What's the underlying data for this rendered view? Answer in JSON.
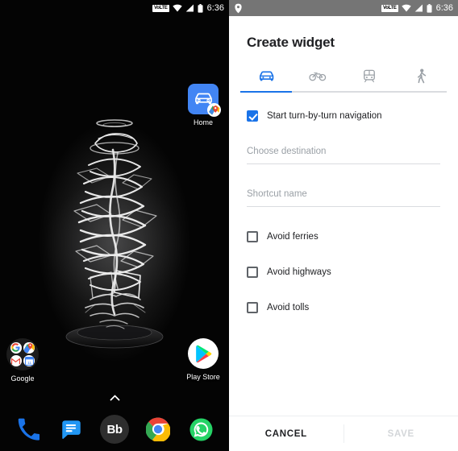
{
  "home_screen": {
    "status_bar": {
      "network_badge": "VoLTE",
      "wifi_icon": "wifi-icon",
      "signal_icon": "signal-icon",
      "battery_icon": "battery-icon",
      "time": "6:36"
    },
    "wallpaper_description": "abstract white light-trail sculpture on black background",
    "icons": [
      {
        "name": "home-shortcut",
        "label": "Home",
        "icon": "car-maps-icon",
        "accent": "#4285F4"
      },
      {
        "name": "google-folder",
        "label": "Google",
        "icon": "folder-icon"
      },
      {
        "name": "play-store",
        "label": "Play Store",
        "icon": "play-store-icon"
      }
    ],
    "drawer_handle_icon": "chevron-up-icon",
    "dock": [
      {
        "name": "phone",
        "label": "Phone",
        "icon": "phone-icon",
        "color": "#1a73e8"
      },
      {
        "name": "messages",
        "label": "Messages",
        "icon": "messages-icon",
        "color": "#2196f3"
      },
      {
        "name": "bb",
        "label": "Bb",
        "icon": "bb-icon",
        "color": "#2e2e2e"
      },
      {
        "name": "chrome",
        "label": "Chrome",
        "icon": "chrome-icon",
        "color": "#4285F4"
      },
      {
        "name": "whatsapp",
        "label": "WhatsApp",
        "icon": "whatsapp-icon",
        "color": "#25D366"
      }
    ]
  },
  "widget_dialog": {
    "status_bar": {
      "location_icon": "location-pin-icon",
      "network_badge": "VoLTE",
      "time": "6:36"
    },
    "title": "Create widget",
    "accent_color": "#1a73e8",
    "tabs": [
      {
        "name": "driving",
        "icon": "car-icon",
        "selected": true
      },
      {
        "name": "cycling",
        "icon": "bicycle-icon",
        "selected": false
      },
      {
        "name": "transit",
        "icon": "train-icon",
        "selected": false
      },
      {
        "name": "walking",
        "icon": "walking-icon",
        "selected": false
      }
    ],
    "navigation_option": {
      "label": "Start turn-by-turn navigation",
      "checked": true
    },
    "fields": [
      {
        "name": "destination",
        "value": "",
        "placeholder": "Choose destination"
      },
      {
        "name": "shortcut-name",
        "value": "",
        "placeholder": "Shortcut name"
      }
    ],
    "options": [
      {
        "name": "avoid-ferries",
        "label": "Avoid ferries",
        "checked": false
      },
      {
        "name": "avoid-highways",
        "label": "Avoid highways",
        "checked": false
      },
      {
        "name": "avoid-tolls",
        "label": "Avoid tolls",
        "checked": false
      }
    ],
    "actions": {
      "cancel_label": "CANCEL",
      "save_label": "SAVE",
      "save_enabled": false
    }
  }
}
